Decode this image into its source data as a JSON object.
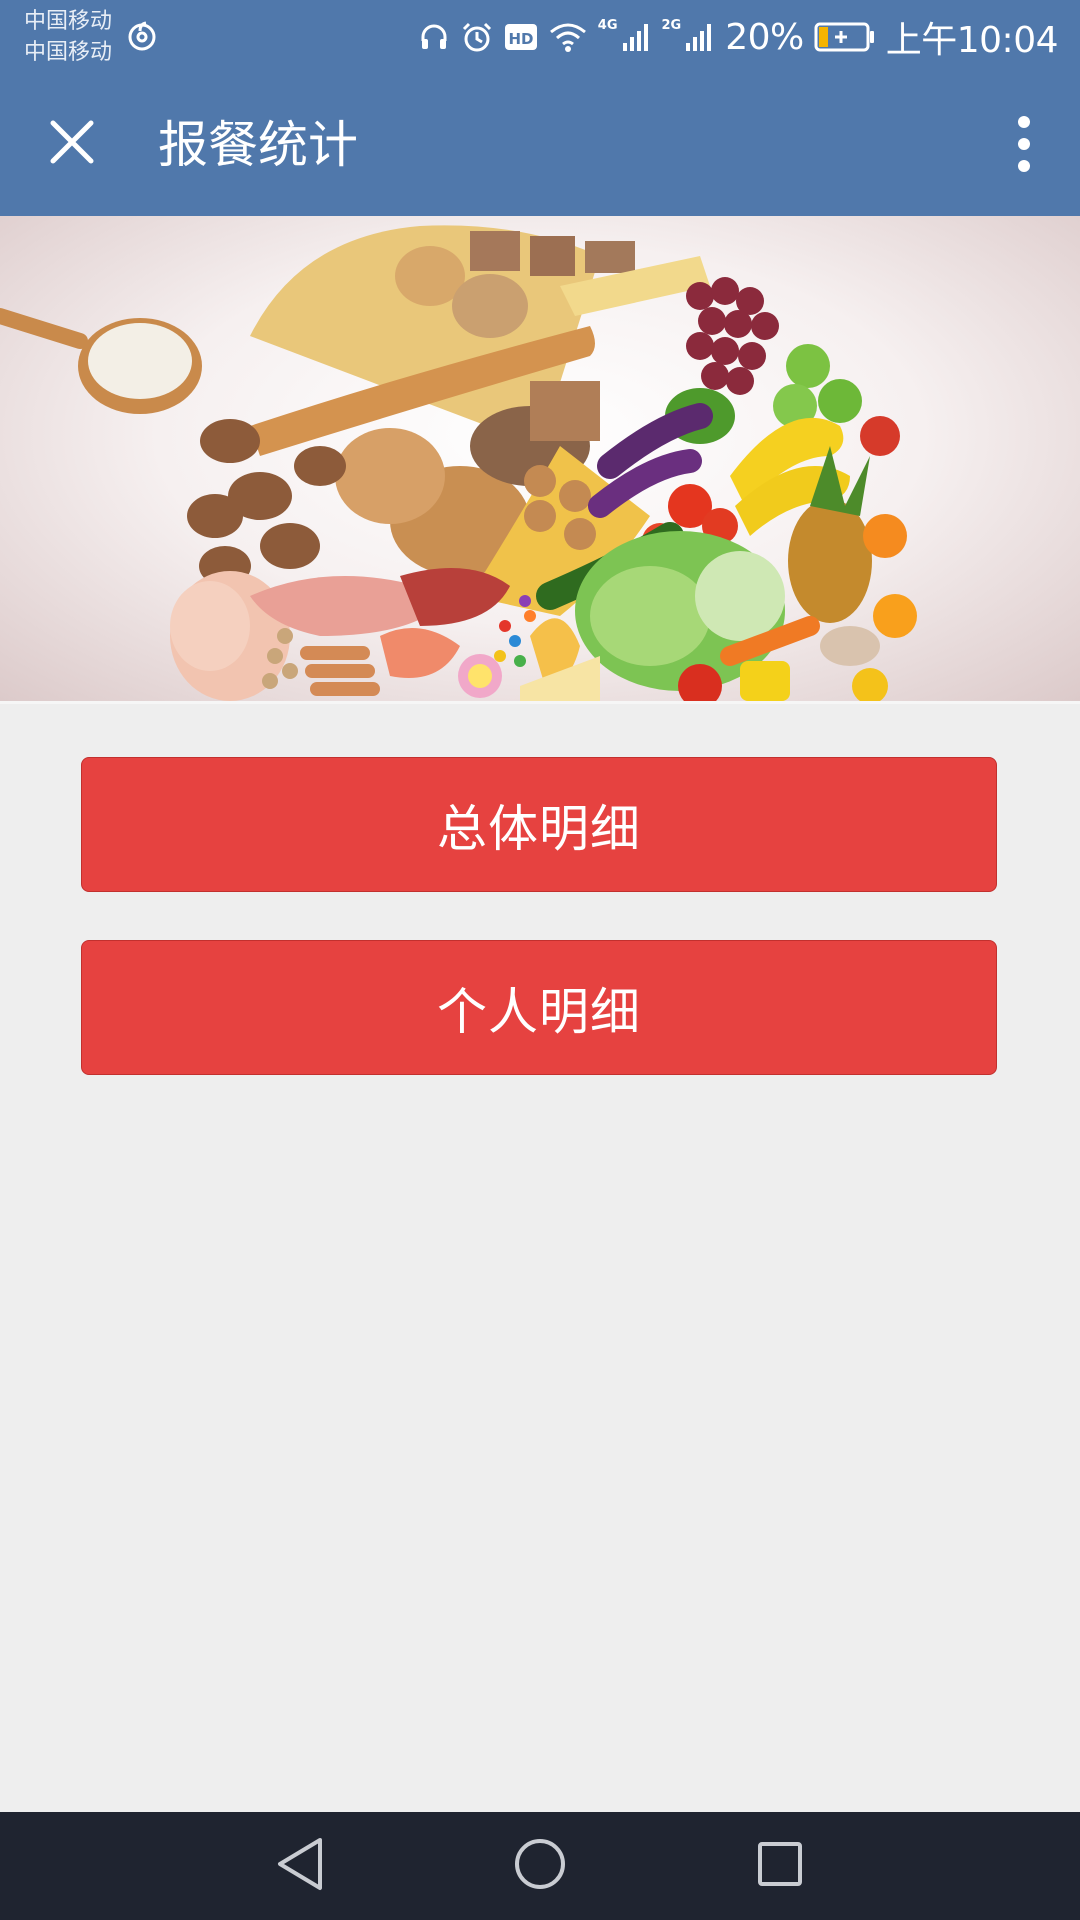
{
  "status_bar": {
    "carrier_1": "中国移动",
    "carrier_2": "中国移动",
    "network_1": "4G",
    "network_2": "2G",
    "battery": "20%",
    "time": "上午10:04",
    "icons": [
      "netease-music-icon",
      "headset-icon",
      "alarm-icon",
      "hd-icon",
      "wifi-icon",
      "signal-icon",
      "signal-icon",
      "battery-charging-icon"
    ],
    "battery_level": 0.2,
    "battery_color": "#f5b400"
  },
  "header": {
    "title": "报餐统计",
    "close_icon": "close-icon",
    "more_icon": "more-vertical-icon",
    "background": "#5078ab"
  },
  "banner": {
    "image": "food-assortment-banner"
  },
  "buttons": {
    "overall": "总体明细",
    "personal": "个人明细",
    "color": "#e64240"
  },
  "nav_bar": {
    "icons": [
      "back-icon",
      "home-icon",
      "recent-apps-icon"
    ]
  }
}
